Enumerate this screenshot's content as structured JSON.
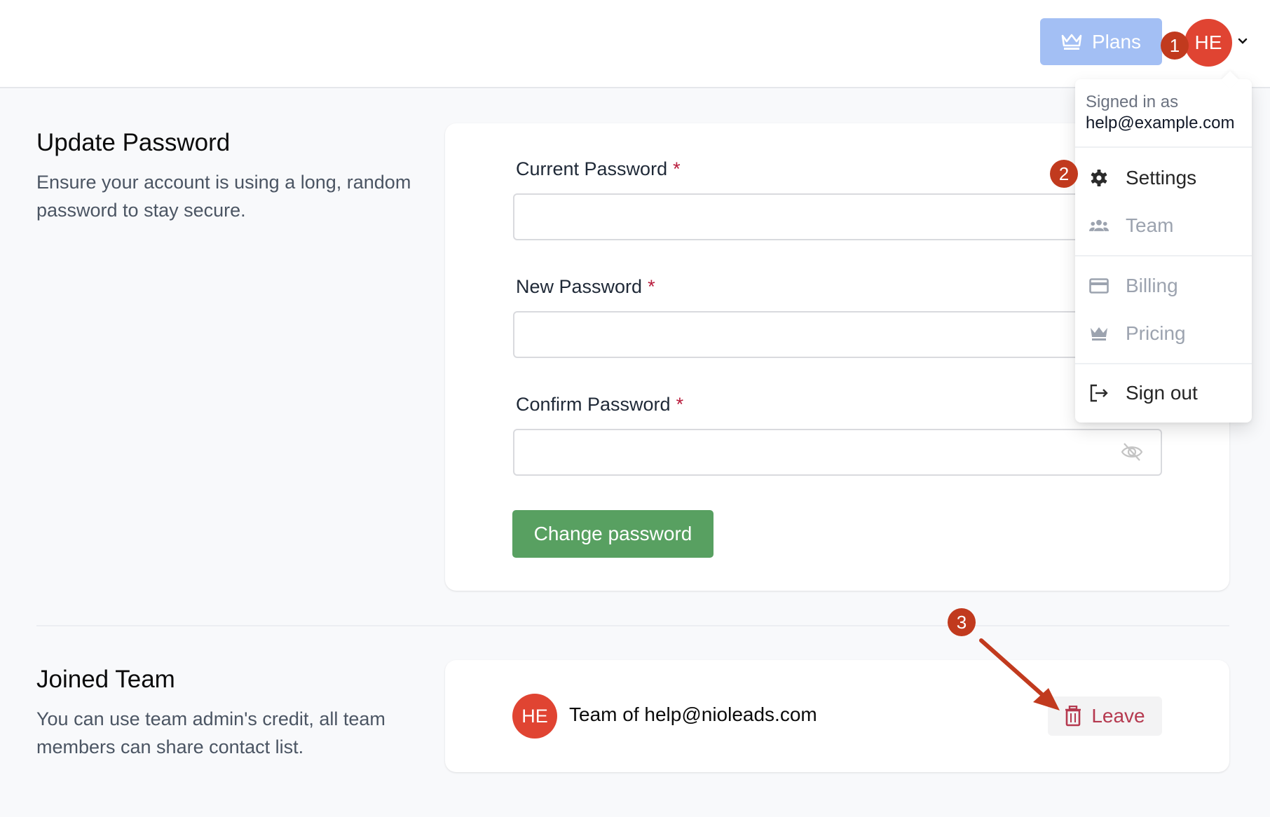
{
  "header": {
    "plans_label": "Plans",
    "plans_icon": "crown-icon",
    "avatar_initials": "HE",
    "chevron_icon": "chevron-down-icon"
  },
  "annotations": {
    "badge_1": "1",
    "badge_2": "2",
    "badge_3": "3"
  },
  "update_password": {
    "title": "Update Password",
    "description": "Ensure your account is using a long, random password to stay secure.",
    "fields": [
      {
        "label": "Current Password",
        "required_mark": "*",
        "value": "",
        "placeholder": ""
      },
      {
        "label": "New Password",
        "required_mark": "*",
        "value": "",
        "placeholder": ""
      },
      {
        "label": "Confirm Password",
        "required_mark": "*",
        "value": "",
        "placeholder": ""
      }
    ],
    "toggle_icon": "eye-off-icon",
    "submit_label": "Change password"
  },
  "joined_team": {
    "title": "Joined Team",
    "description": "You can use team admin's credit, all team members can share contact list.",
    "team_avatar_initials": "HE",
    "team_name": "Team of help@nioleads.com",
    "leave_label": "Leave",
    "leave_icon": "trash-icon"
  },
  "user_menu": {
    "signed_in_label": "Signed in as",
    "email": "help@example.com",
    "items": [
      {
        "label": "Settings",
        "icon": "gear-icon",
        "state": "enabled"
      },
      {
        "label": "Team",
        "icon": "users-icon",
        "state": "disabled"
      },
      {
        "label": "Billing",
        "icon": "credit-card-icon",
        "state": "disabled"
      },
      {
        "label": "Pricing",
        "icon": "crown-icon",
        "state": "disabled"
      },
      {
        "label": "Sign out",
        "icon": "sign-out-icon",
        "state": "enabled"
      }
    ]
  },
  "colors": {
    "primary_light": "#a3bff4",
    "avatar": "#e04432",
    "annotation": "#c13a1e",
    "success": "#58a061",
    "danger_text": "#b5394f",
    "required": "#b91c3c"
  }
}
